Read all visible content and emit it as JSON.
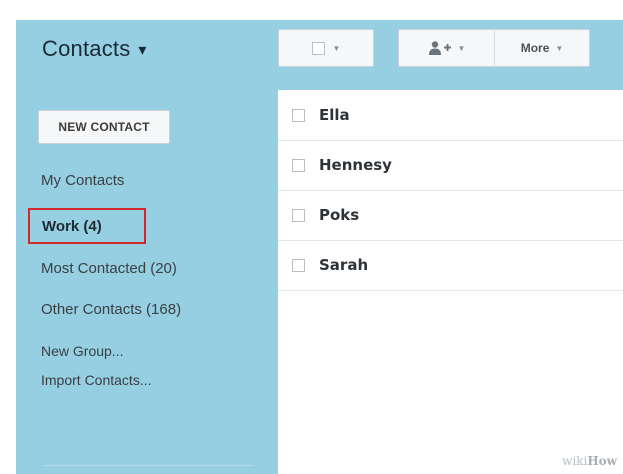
{
  "header": {
    "title": "Contacts",
    "more_label": "More"
  },
  "sidebar": {
    "new_contact_label": "NEW CONTACT",
    "items": [
      {
        "label": "My Contacts"
      },
      {
        "label": "Work (4)",
        "selected": true
      },
      {
        "label": "Most Contacted (20)"
      },
      {
        "label": "Other Contacts (168)"
      },
      {
        "label": "New Group..."
      },
      {
        "label": "Import Contacts..."
      }
    ]
  },
  "contacts": [
    {
      "name": "Ella"
    },
    {
      "name": "Hennesy"
    },
    {
      "name": "Poks"
    },
    {
      "name": "Sarah"
    }
  ],
  "watermark": {
    "text_light": "wiki",
    "text_bold": "How"
  },
  "colors": {
    "panel": "#95cfe1",
    "highlight_box": "#d0252a"
  },
  "icons": [
    "checkbox-icon",
    "add-person-icon",
    "chevron-down-icon"
  ]
}
